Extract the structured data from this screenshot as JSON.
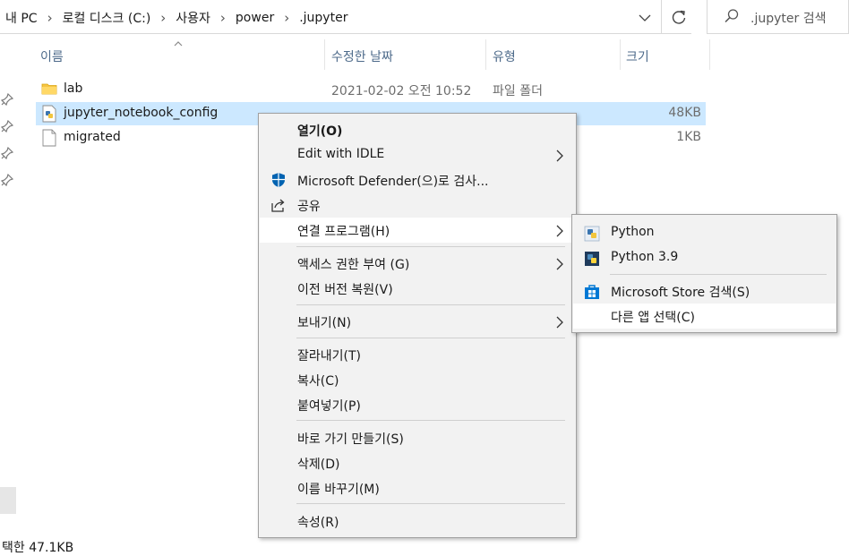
{
  "address": {
    "crumbs": [
      "내 PC",
      "로컬 디스크 (C:)",
      "사용자",
      "power",
      ".jupyter"
    ],
    "separator": "›"
  },
  "search": {
    "placeholder": ".jupyter 검색"
  },
  "columns": {
    "name": "이름",
    "date": "수정한 날짜",
    "type": "유형",
    "size": "크기"
  },
  "files": [
    {
      "name": "lab",
      "date": "2021-02-02 오전 10:52",
      "type": "파일 폴더",
      "size": "",
      "icon": "folder-icon",
      "selected": false
    },
    {
      "name": "jupyter_notebook_config",
      "date": "",
      "type": "",
      "size": "48KB",
      "icon": "python-file-icon",
      "selected": true
    },
    {
      "name": "migrated",
      "date": "",
      "type": "",
      "size": "1KB",
      "icon": "file-icon",
      "selected": false
    }
  ],
  "status": {
    "text": "택한 47.1KB"
  },
  "context_menu": {
    "open": "열기(O)",
    "edit_idle": "Edit with IDLE",
    "defender": "Microsoft Defender(으)로 검사...",
    "share": "공유",
    "open_with": "연결 프로그램(H)",
    "give_access": "액세스 권한 부여 (G)",
    "restore": "이전 버전 복원(V)",
    "send_to": "보내기(N)",
    "cut": "잘라내기(T)",
    "copy": "복사(C)",
    "paste": "붙여넣기(P)",
    "shortcut": "바로 가기 만들기(S)",
    "delete": "삭제(D)",
    "rename": "이름 바꾸기(M)",
    "properties": "속성(R)"
  },
  "submenu": {
    "python": "Python",
    "python39": "Python 3.9",
    "store": "Microsoft Store 검색(S)",
    "other_app": "다른 앱 선택(C)"
  },
  "colors": {
    "selection": "#cce8ff",
    "menu_bg": "#f2f2f2",
    "defender_blue": "#0063b1"
  }
}
